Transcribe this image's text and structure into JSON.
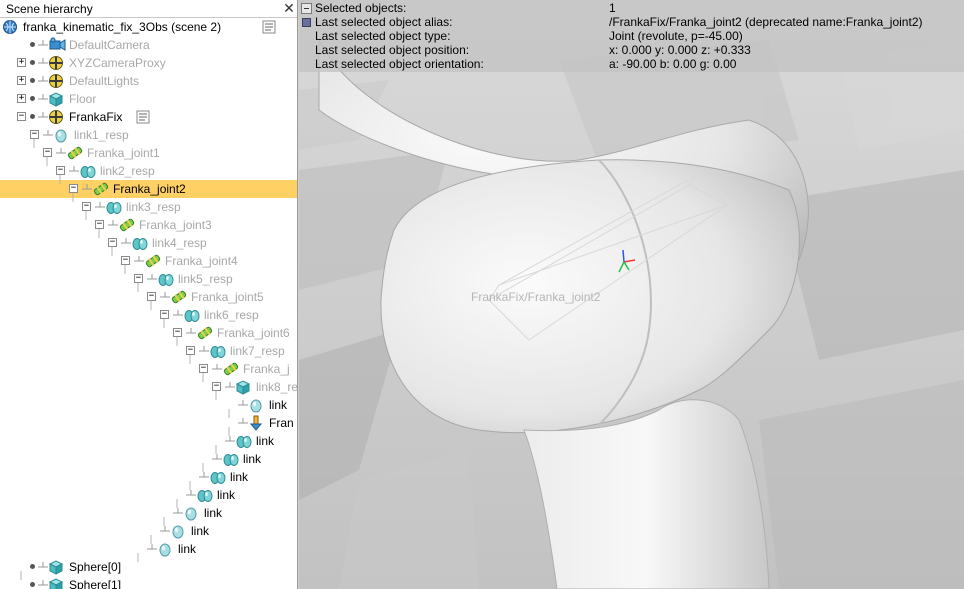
{
  "panel": {
    "title": "Scene hierarchy",
    "close_glyph": "✕"
  },
  "tree": [
    {
      "label": "franka_kinematic_fix_3Obs (scene 2)",
      "icon": "scene-icon",
      "dim": false,
      "expander": "",
      "script": true
    },
    {
      "label": "DefaultCamera",
      "icon": "camera-icon",
      "dim": true,
      "expander": "",
      "script": false
    },
    {
      "label": "XYZCameraProxy",
      "icon": "dummy-icon",
      "dim": true,
      "expander": "+",
      "script": false
    },
    {
      "label": "DefaultLights",
      "icon": "dummy-icon",
      "dim": true,
      "expander": "+",
      "script": false
    },
    {
      "label": "Floor",
      "icon": "cuboid-icon",
      "dim": true,
      "expander": "+",
      "script": false
    },
    {
      "label": "FrankaFix",
      "icon": "dummy-icon",
      "dim": false,
      "expander": "-",
      "script": true
    },
    {
      "label": "link1_resp",
      "icon": "respondable-icon",
      "dim": true,
      "expander": "-",
      "script": false
    },
    {
      "label": "Franka_joint1",
      "icon": "joint-icon",
      "dim": true,
      "expander": "-",
      "script": false
    },
    {
      "label": "link2_resp",
      "icon": "shape-icon",
      "dim": true,
      "expander": "-",
      "script": false
    },
    {
      "label": "Franka_joint2",
      "icon": "joint-icon",
      "dim": false,
      "expander": "-",
      "script": false,
      "selected": true
    },
    {
      "label": "link3_resp",
      "icon": "shape-icon",
      "dim": true,
      "expander": "-",
      "script": false
    },
    {
      "label": "Franka_joint3",
      "icon": "joint-icon",
      "dim": true,
      "expander": "-",
      "script": false
    },
    {
      "label": "link4_resp",
      "icon": "shape-icon",
      "dim": true,
      "expander": "-",
      "script": false
    },
    {
      "label": "Franka_joint4",
      "icon": "joint-icon",
      "dim": true,
      "expander": "-",
      "script": false
    },
    {
      "label": "link5_resp",
      "icon": "shape-icon",
      "dim": true,
      "expander": "-",
      "script": false
    },
    {
      "label": "Franka_joint5",
      "icon": "joint-icon",
      "dim": true,
      "expander": "-",
      "script": false
    },
    {
      "label": "link6_resp",
      "icon": "shape-icon",
      "dim": true,
      "expander": "-",
      "script": false
    },
    {
      "label": "Franka_joint6",
      "icon": "joint-icon",
      "dim": true,
      "expander": "-",
      "script": false
    },
    {
      "label": "link7_resp",
      "icon": "shape-icon",
      "dim": true,
      "expander": "-",
      "script": false
    },
    {
      "label": "Franka_j",
      "icon": "joint-icon",
      "dim": true,
      "expander": "-",
      "script": false
    },
    {
      "label": "link8_re",
      "icon": "cuboid-icon",
      "dim": true,
      "expander": "-",
      "script": false
    },
    {
      "label": "link",
      "icon": "respondable-icon",
      "dim": false,
      "expander": "",
      "script": false
    },
    {
      "label": "Fran",
      "icon": "force-sensor-icon",
      "dim": false,
      "expander": "",
      "script": false
    },
    {
      "label": "link",
      "icon": "shape-icon",
      "dim": false,
      "expander": "",
      "script": false
    },
    {
      "label": "link",
      "icon": "shape-icon",
      "dim": false,
      "expander": "",
      "script": false
    },
    {
      "label": "link",
      "icon": "shape-icon",
      "dim": false,
      "expander": "",
      "script": false
    },
    {
      "label": "link",
      "icon": "shape-icon",
      "dim": false,
      "expander": "",
      "script": false
    },
    {
      "label": "link",
      "icon": "respondable-icon",
      "dim": false,
      "expander": "",
      "script": false
    },
    {
      "label": "link",
      "icon": "respondable-icon",
      "dim": false,
      "expander": "",
      "script": false
    },
    {
      "label": "link",
      "icon": "respondable-icon",
      "dim": false,
      "expander": "",
      "script": false
    },
    {
      "label": "Sphere[0]",
      "icon": "cuboid-icon",
      "dim": false,
      "expander": "",
      "script": false
    },
    {
      "label": "Sphere[1]",
      "icon": "cuboid-icon",
      "dim": false,
      "expander": "",
      "script": false
    }
  ],
  "info": {
    "rows": [
      {
        "key": "Selected objects:",
        "value": "1"
      },
      {
        "key": "Last selected object alias:",
        "value": "/FrankaFix/Franka_joint2    (deprecated name:Franka_joint2)"
      },
      {
        "key": "Last selected object type:",
        "value": "Joint (revolute, p=-45.00)"
      },
      {
        "key": "Last selected object position:",
        "value": "x: 0.000    y: 0.000    z: +0.333"
      },
      {
        "key": "Last selected object orientation:",
        "value": "a: -90.00    b: 0.00    g: 0.00"
      }
    ]
  },
  "viewport": {
    "object_label": "FrankaFix/Franka_joint2"
  },
  "colors": {
    "selection": "#ffd064",
    "dim_text": "#a8a8a8",
    "joint_green": "#6cc24a",
    "shape_cyan": "#5fc4c8"
  }
}
